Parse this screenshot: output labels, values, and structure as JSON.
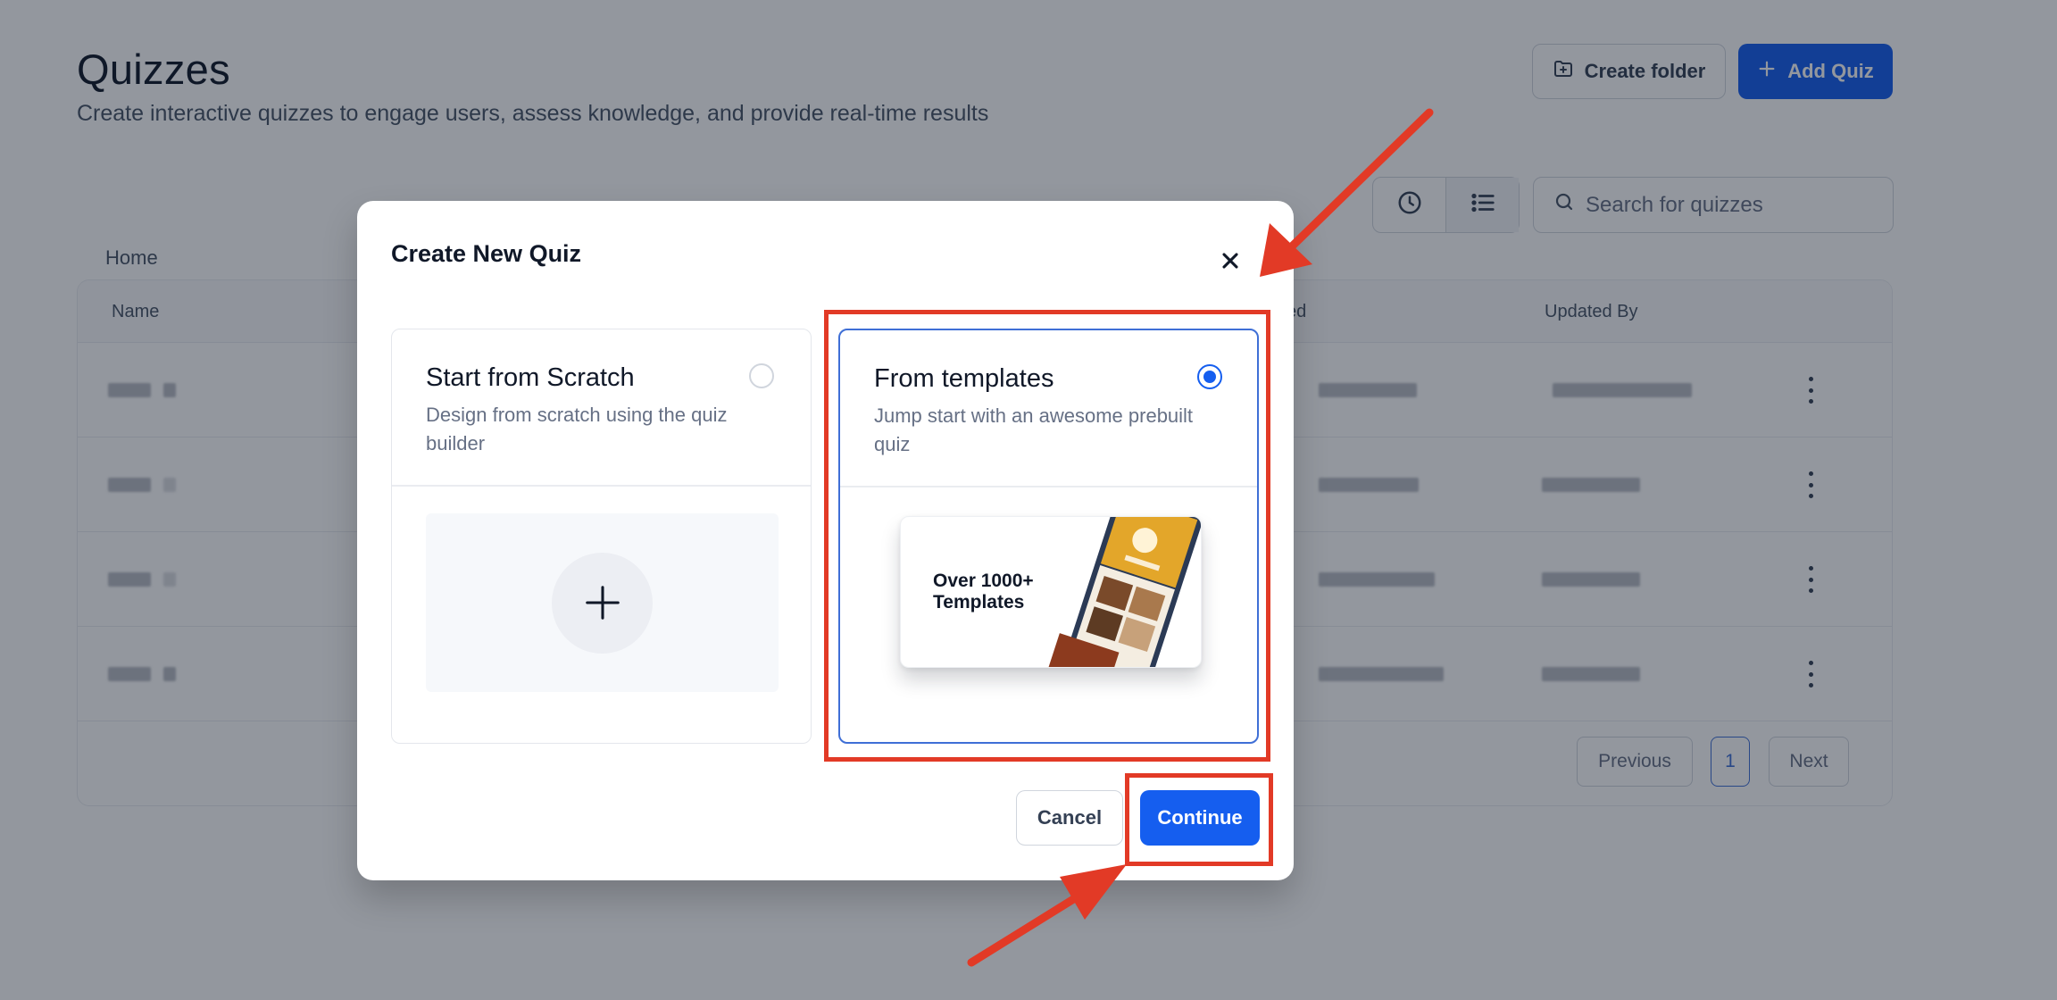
{
  "page": {
    "title": "Quizzes",
    "subtitle": "Create interactive quizzes to engage users, assess knowledge, and provide real-time results"
  },
  "toolbar": {
    "create_folder_label": "Create folder",
    "add_quiz_label": "Add Quiz",
    "search_placeholder": "Search for quizzes"
  },
  "breadcrumb": {
    "home": "Home"
  },
  "table": {
    "columns": [
      "Name",
      "ed",
      "Updated By"
    ],
    "row_count": 4
  },
  "pagination": {
    "previous_label": "Previous",
    "current_page": "1",
    "next_label": "Next"
  },
  "modal": {
    "title": "Create New Quiz",
    "options": [
      {
        "title": "Start from Scratch",
        "description": "Design from scratch using the quiz builder",
        "selected": false
      },
      {
        "title": "From templates",
        "description": "Jump start with an awesome prebuilt quiz",
        "selected": true,
        "preview_text": "Over 1000+ Templates"
      }
    ],
    "cancel_label": "Cancel",
    "continue_label": "Continue"
  },
  "colors": {
    "primary": "#155eef",
    "annotation": "#e23a26",
    "overlay": "rgba(16,24,40,0.45)"
  },
  "icons": {
    "create_folder": "folder-plus-icon",
    "add_quiz": "plus-icon",
    "recent": "clock-icon",
    "list_view": "list-icon",
    "search": "search-icon",
    "close": "close-icon",
    "row_menu": "kebab-icon",
    "add_blank": "plus-icon"
  }
}
